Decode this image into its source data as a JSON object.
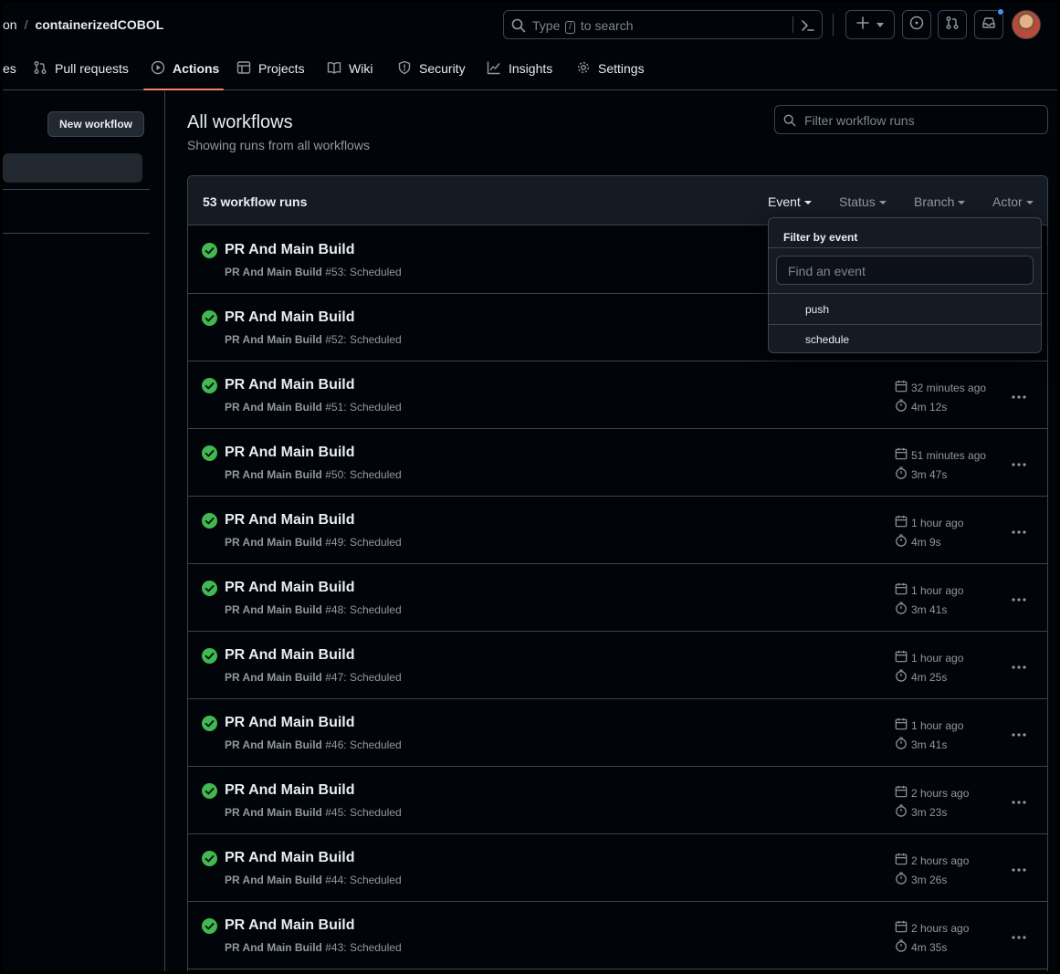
{
  "header": {
    "owner_partial": "on",
    "separator": "/",
    "repo": "containerizedCOBOL",
    "search": {
      "prefix": "Type",
      "key": "/",
      "suffix": "to search"
    }
  },
  "tabs": [
    {
      "label": "es",
      "icon": "code-icon"
    },
    {
      "label": "Pull requests",
      "icon": "git-pull-request-icon"
    },
    {
      "label": "Actions",
      "icon": "play-icon",
      "active": true
    },
    {
      "label": "Projects",
      "icon": "table-icon"
    },
    {
      "label": "Wiki",
      "icon": "book-icon"
    },
    {
      "label": "Security",
      "icon": "shield-icon"
    },
    {
      "label": "Insights",
      "icon": "graph-icon"
    },
    {
      "label": "Settings",
      "icon": "gear-icon"
    }
  ],
  "sidebar": {
    "new_workflow_label": "New workflow"
  },
  "main": {
    "title": "All workflows",
    "subtitle": "Showing runs from all workflows",
    "filter_placeholder": "Filter workflow runs",
    "runs_count": "53 workflow runs",
    "filters": {
      "event": "Event",
      "status": "Status",
      "branch": "Branch",
      "actor": "Actor"
    }
  },
  "dropdown": {
    "title": "Filter by event",
    "placeholder": "Find an event",
    "items": [
      "push",
      "schedule"
    ]
  },
  "runs": [
    {
      "title": "PR And Main Build",
      "workflow": "PR And Main Build",
      "number": "#53",
      "event": "Scheduled",
      "time": "",
      "duration": ""
    },
    {
      "title": "PR And Main Build",
      "workflow": "PR And Main Build",
      "number": "#52",
      "event": "Scheduled",
      "time": "",
      "duration": ""
    },
    {
      "title": "PR And Main Build",
      "workflow": "PR And Main Build",
      "number": "#51",
      "event": "Scheduled",
      "time": "32 minutes ago",
      "duration": "4m 12s"
    },
    {
      "title": "PR And Main Build",
      "workflow": "PR And Main Build",
      "number": "#50",
      "event": "Scheduled",
      "time": "51 minutes ago",
      "duration": "3m 47s"
    },
    {
      "title": "PR And Main Build",
      "workflow": "PR And Main Build",
      "number": "#49",
      "event": "Scheduled",
      "time": "1 hour ago",
      "duration": "4m 9s"
    },
    {
      "title": "PR And Main Build",
      "workflow": "PR And Main Build",
      "number": "#48",
      "event": "Scheduled",
      "time": "1 hour ago",
      "duration": "3m 41s"
    },
    {
      "title": "PR And Main Build",
      "workflow": "PR And Main Build",
      "number": "#47",
      "event": "Scheduled",
      "time": "1 hour ago",
      "duration": "4m 25s"
    },
    {
      "title": "PR And Main Build",
      "workflow": "PR And Main Build",
      "number": "#46",
      "event": "Scheduled",
      "time": "1 hour ago",
      "duration": "3m 41s"
    },
    {
      "title": "PR And Main Build",
      "workflow": "PR And Main Build",
      "number": "#45",
      "event": "Scheduled",
      "time": "2 hours ago",
      "duration": "3m 23s"
    },
    {
      "title": "PR And Main Build",
      "workflow": "PR And Main Build",
      "number": "#44",
      "event": "Scheduled",
      "time": "2 hours ago",
      "duration": "3m 26s"
    },
    {
      "title": "PR And Main Build",
      "workflow": "PR And Main Build",
      "number": "#43",
      "event": "Scheduled",
      "time": "2 hours ago",
      "duration": "4m 35s"
    }
  ],
  "colors": {
    "success": "#3fb950",
    "accent_underline": "#f78166",
    "notification_dot": "#4493f8"
  }
}
